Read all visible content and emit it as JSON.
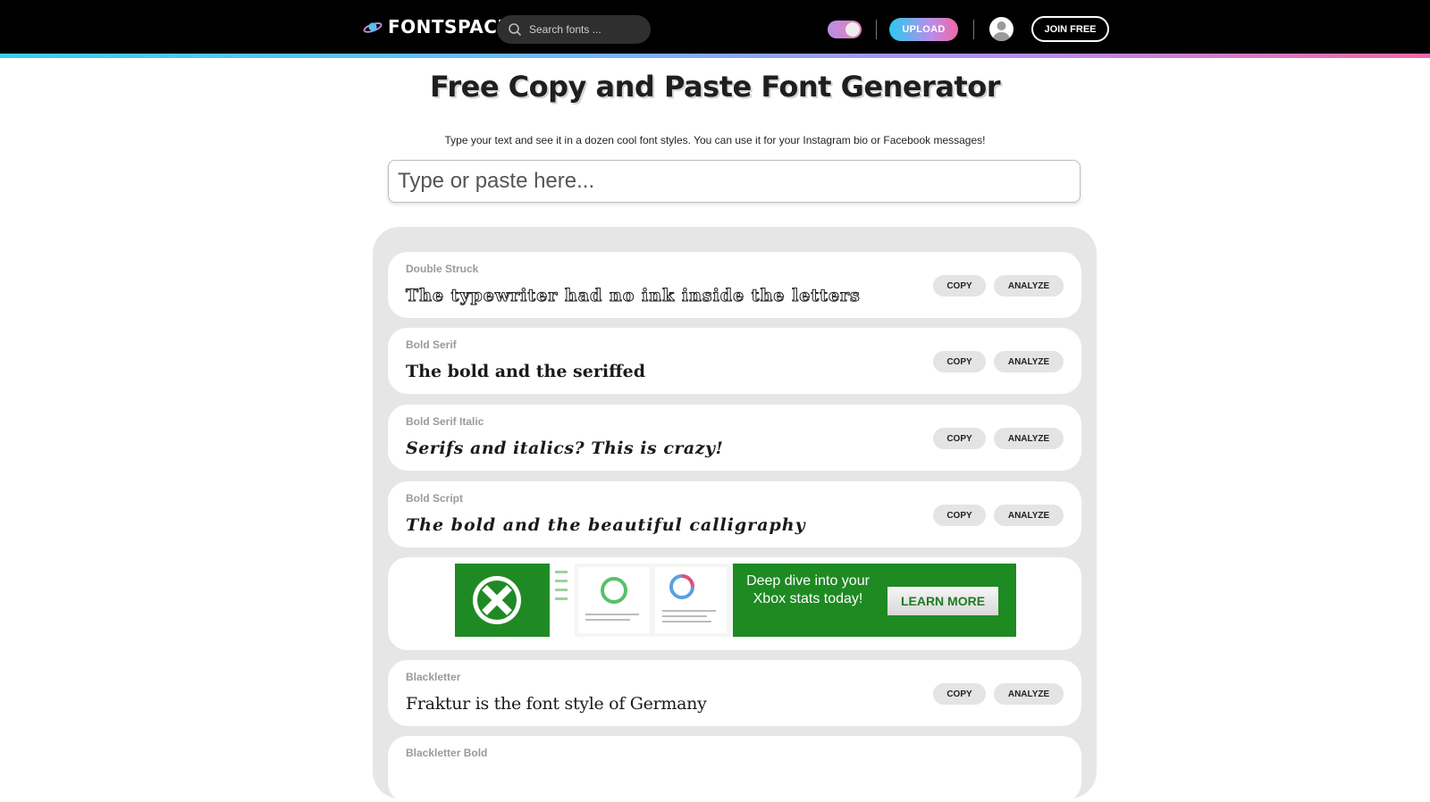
{
  "header": {
    "logo_text": "FONTSPACE",
    "search_placeholder": "Search fonts ...",
    "upload_label": "UPLOAD",
    "join_label": "JOIN FREE"
  },
  "page": {
    "title": "Free Copy and Paste Font Generator",
    "subtitle": "Type your text and see it in a dozen cool font styles. You can use it for your Instagram bio or Facebook messages!",
    "input_placeholder": "Type or paste here..."
  },
  "buttons": {
    "copy": "COPY",
    "analyze": "ANALYZE"
  },
  "styles": [
    {
      "name": "Double Struck",
      "sample": "The typewriter had no ink inside the letters"
    },
    {
      "name": "Bold Serif",
      "sample": "The bold and the seriffed"
    },
    {
      "name": "Bold Serif Italic",
      "sample": "Serifs and italics? This is crazy!"
    },
    {
      "name": "Bold Script",
      "sample": "The bold and the beautiful calligraphy"
    },
    {
      "name": "Blackletter",
      "sample": "Fraktur is the font style of Germany"
    },
    {
      "name": "Blackletter Bold",
      "sample": ""
    }
  ],
  "ad": {
    "text": "Deep dive into your Xbox stats today!",
    "button": "LEARN MORE"
  },
  "colors": {
    "brand_gradient": [
      "#3ad0f0",
      "#b48ef0",
      "#f06aa8"
    ],
    "ad_green": "#1e8a22"
  }
}
